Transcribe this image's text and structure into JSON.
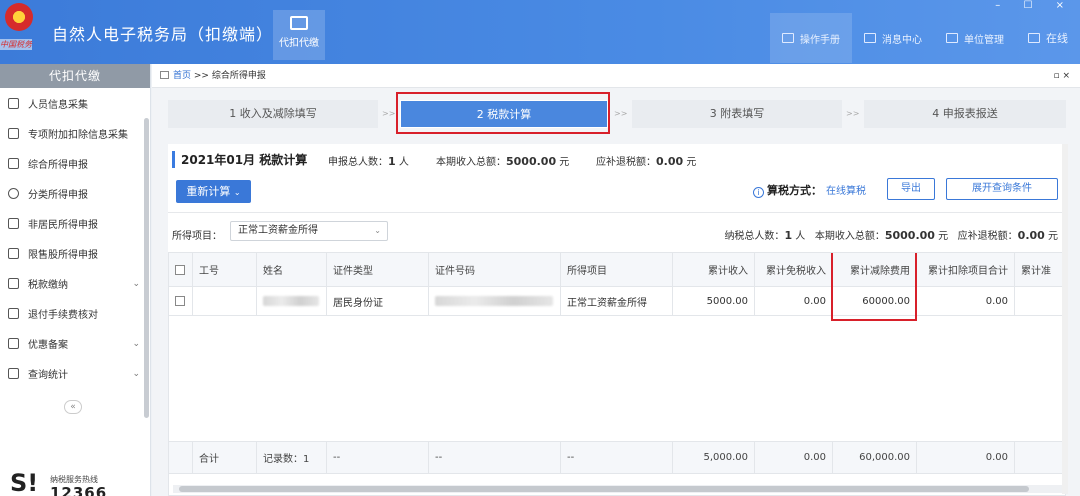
{
  "header": {
    "app_title": "自然人电子税务局（扣缴端）",
    "emblem_seal_text": "中国税务",
    "module_label": "代扣代缴",
    "nav": [
      {
        "label": "操作手册",
        "icon": "manual-icon"
      },
      {
        "label": "消息中心",
        "icon": "mail-icon"
      },
      {
        "label": "单位管理",
        "icon": "building-icon"
      },
      {
        "label": "在线",
        "icon": "online-icon"
      }
    ],
    "window_controls": "– ☐ ×"
  },
  "sidebar": {
    "title": "代扣代缴",
    "items": [
      {
        "label": "人员信息采集",
        "icon": "person-icon",
        "has_arrow": false
      },
      {
        "label": "专项附加扣除信息采集",
        "icon": "list-icon",
        "has_arrow": false
      },
      {
        "label": "综合所得申报",
        "icon": "layers-icon",
        "has_arrow": false
      },
      {
        "label": "分类所得申报",
        "icon": "pie-icon",
        "has_arrow": false
      },
      {
        "label": "非居民所得申报",
        "icon": "person-outline-icon",
        "has_arrow": false
      },
      {
        "label": "限售股所得申报",
        "icon": "bar-icon",
        "has_arrow": false
      },
      {
        "label": "税款缴纳",
        "icon": "folder-icon",
        "has_arrow": true
      },
      {
        "label": "退付手续费核对",
        "icon": "doc-icon",
        "has_arrow": false
      },
      {
        "label": "优惠备案",
        "icon": "note-icon",
        "has_arrow": true
      },
      {
        "label": "查询统计",
        "icon": "query-icon",
        "has_arrow": true
      }
    ],
    "collapse": "«",
    "hotline_label": "纳税服务热线",
    "hotline_number": "12366"
  },
  "breadcrumb": {
    "home": "首页",
    "sep": ">>",
    "current": "综合所得申报"
  },
  "steps": [
    {
      "label": "1 收入及减除填写",
      "active": false
    },
    {
      "label": "2 税款计算",
      "active": true
    },
    {
      "label": "3 附表填写",
      "active": false
    },
    {
      "label": "4 申报表报送",
      "active": false
    }
  ],
  "step_sep": ">>",
  "panel": {
    "title": "2021年01月 税款计算",
    "info1_label": "申报总人数：",
    "info1_value": "1",
    "info1_unit": "人",
    "info2_label": "本期收入总额：",
    "info2_value": "5000.00",
    "info2_unit": "元",
    "info3_label": "应补退税额：",
    "info3_value": "0.00",
    "info3_unit": "元",
    "recalc_label": "重新计算",
    "taxmode_label": "算税方式：",
    "taxmode_value": "在线算税",
    "export_label": "导出",
    "expand_label": "展开查询条件",
    "filter_label": "所得项目：",
    "filter_value": "正常工资薪金所得",
    "sum_people_label": "纳税总人数：",
    "sum_people_value": "1",
    "sum_people_unit": "人",
    "sum_income_label": "本期收入总额：",
    "sum_income_value": "5000.00",
    "sum_income_unit": "元",
    "sum_tax_label": "应补退税额：",
    "sum_tax_value": "0.00",
    "sum_tax_unit": "元"
  },
  "table": {
    "headers": [
      "工号",
      "姓名",
      "证件类型",
      "证件号码",
      "所得项目",
      "累计收入",
      "累计免税收入",
      "累计减除费用",
      "累计扣除项目合计",
      "累计准"
    ],
    "rows": [
      {
        "emp_no": "",
        "name": "",
        "id_type": "居民身份证",
        "id_no": "",
        "item": "正常工资薪金所得",
        "income": "5000.00",
        "tax_free": "0.00",
        "deduction": "60000.00",
        "deduct_total": "0.00",
        "extra": ""
      }
    ],
    "footer": {
      "label": "合计",
      "records": "记录数：1",
      "dash1": "--",
      "dash2": "--",
      "dash3": "--",
      "income": "5,000.00",
      "tax_free": "0.00",
      "deduction": "60,000.00",
      "deduct_total": "0.00"
    }
  },
  "colors": {
    "header_blue": "#4a8be4",
    "accent": "#3a78d8",
    "highlight_red": "#d8202a"
  }
}
